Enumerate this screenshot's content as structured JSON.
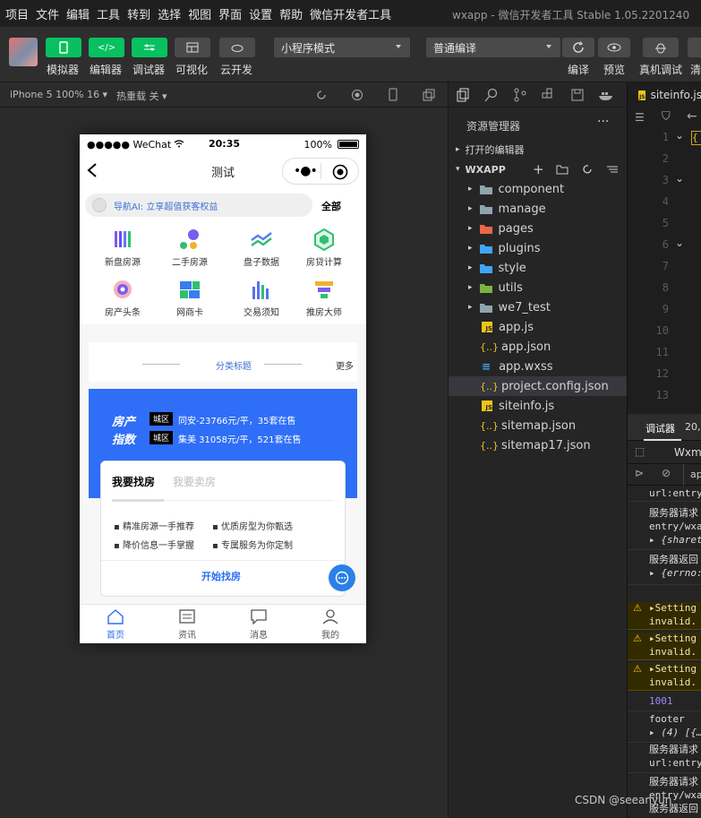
{
  "menubar": {
    "items": [
      "项目",
      "文件",
      "编辑",
      "工具",
      "转到",
      "选择",
      "视图",
      "界面",
      "设置",
      "帮助",
      "微信开发者工具"
    ],
    "window_title": "wxapp - 微信开发者工具 Stable 1.05.2201240"
  },
  "toolbar": {
    "simulator": "模拟器",
    "editor": "编辑器",
    "debugger": "调试器",
    "visual": "可视化",
    "cloud": "云开发",
    "mode_select": "小程序模式",
    "compile_select": "普通编译",
    "compile": "编译",
    "preview": "预览",
    "real_debug": "真机调试",
    "clear": "清"
  },
  "subbar": {
    "device": "iPhone 5 100% 16 ▾",
    "hotreload": "热重载 关 ▾"
  },
  "phone": {
    "status": {
      "carrier": "●●●●● WeChat",
      "time": "20:35",
      "battery": "100%"
    },
    "nav_title": "测试",
    "search_text": "导航AI: 立享超值获客权益",
    "search_all": "全部",
    "grid": [
      {
        "label": "新盘房源",
        "color": "#7b5cf0"
      },
      {
        "label": "二手房源",
        "color": "#6b4cf0"
      },
      {
        "label": "盘子数据",
        "color": "#5a7cf0"
      },
      {
        "label": "房贷计算",
        "color": "#2fbf71"
      },
      {
        "label": "房产头条",
        "color": "#e85f73"
      },
      {
        "label": "网商卡",
        "color": "#3a7cf0"
      },
      {
        "label": "交易须知",
        "color": "#5a6ef0"
      },
      {
        "label": "推房大师",
        "color": "#f0b429"
      }
    ],
    "section_title": "分类标题",
    "section_more": "更多",
    "housing": {
      "label1": "房产",
      "label2": "指数",
      "tag": "城区",
      "line1": "同安-23766元/平，35套在售",
      "line2": "集美 31058元/平，521套在售"
    },
    "card": {
      "tab_active": "我要找房",
      "tab_inactive": "我要卖房",
      "features": [
        "精准房源一手推荐",
        "优质房型为你甄选",
        "降价信息一手掌握",
        "专属服务为你定制"
      ],
      "action": "开始找房"
    },
    "tabs": [
      "首页",
      "资讯",
      "消息",
      "我的"
    ]
  },
  "explorer": {
    "title": "资源管理器",
    "open_editors": "打开的编辑器",
    "root": "WXAPP",
    "folders": [
      "component",
      "manage",
      "pages",
      "plugins",
      "style",
      "utils",
      "we7_test"
    ],
    "files": [
      "app.js",
      "app.json",
      "app.wxss",
      "project.config.json",
      "siteinfo.js",
      "sitemap.json",
      "sitemap17.json"
    ],
    "selected": "project.config.json"
  },
  "editor": {
    "tab": "siteinfo.js",
    "line_numbers": [
      "1",
      "2",
      "3",
      "4",
      "5",
      "6",
      "7",
      "8",
      "9",
      "10",
      "11",
      "12",
      "13"
    ]
  },
  "console": {
    "tab": "调试器",
    "tab_count": "20,",
    "subtab": "Wxml",
    "filter": "ap",
    "rows": [
      {
        "text": "url:entry",
        "type": "log"
      },
      {
        "text": "服务器请求",
        "type": "log"
      },
      {
        "text": "entry/wxa",
        "type": "log"
      },
      {
        "text": "▸ {sharet",
        "type": "log"
      },
      {
        "text": "服务器返回",
        "type": "log"
      },
      {
        "text": "▸ {errno:",
        "type": "log"
      },
      {
        "text": "▸Setting",
        "type": "warn"
      },
      {
        "text": "invalid.",
        "type": "warn"
      },
      {
        "text": "▸Setting",
        "type": "warn"
      },
      {
        "text": "invalid.",
        "type": "warn"
      },
      {
        "text": "▸Setting",
        "type": "warn"
      },
      {
        "text": "invalid.",
        "type": "warn"
      },
      {
        "text": "1001",
        "type": "num"
      },
      {
        "text": "footer",
        "type": "log"
      },
      {
        "text": "▸ (4) [{…",
        "type": "log"
      },
      {
        "text": "服务器请求",
        "type": "log"
      },
      {
        "text": "url:entry",
        "type": "log"
      },
      {
        "text": "服务器请求",
        "type": "log"
      },
      {
        "text": "entry/wxa",
        "type": "log"
      },
      {
        "text": "服务器返回",
        "type": "log"
      }
    ]
  },
  "watermark": "CSDN @seeanyun"
}
